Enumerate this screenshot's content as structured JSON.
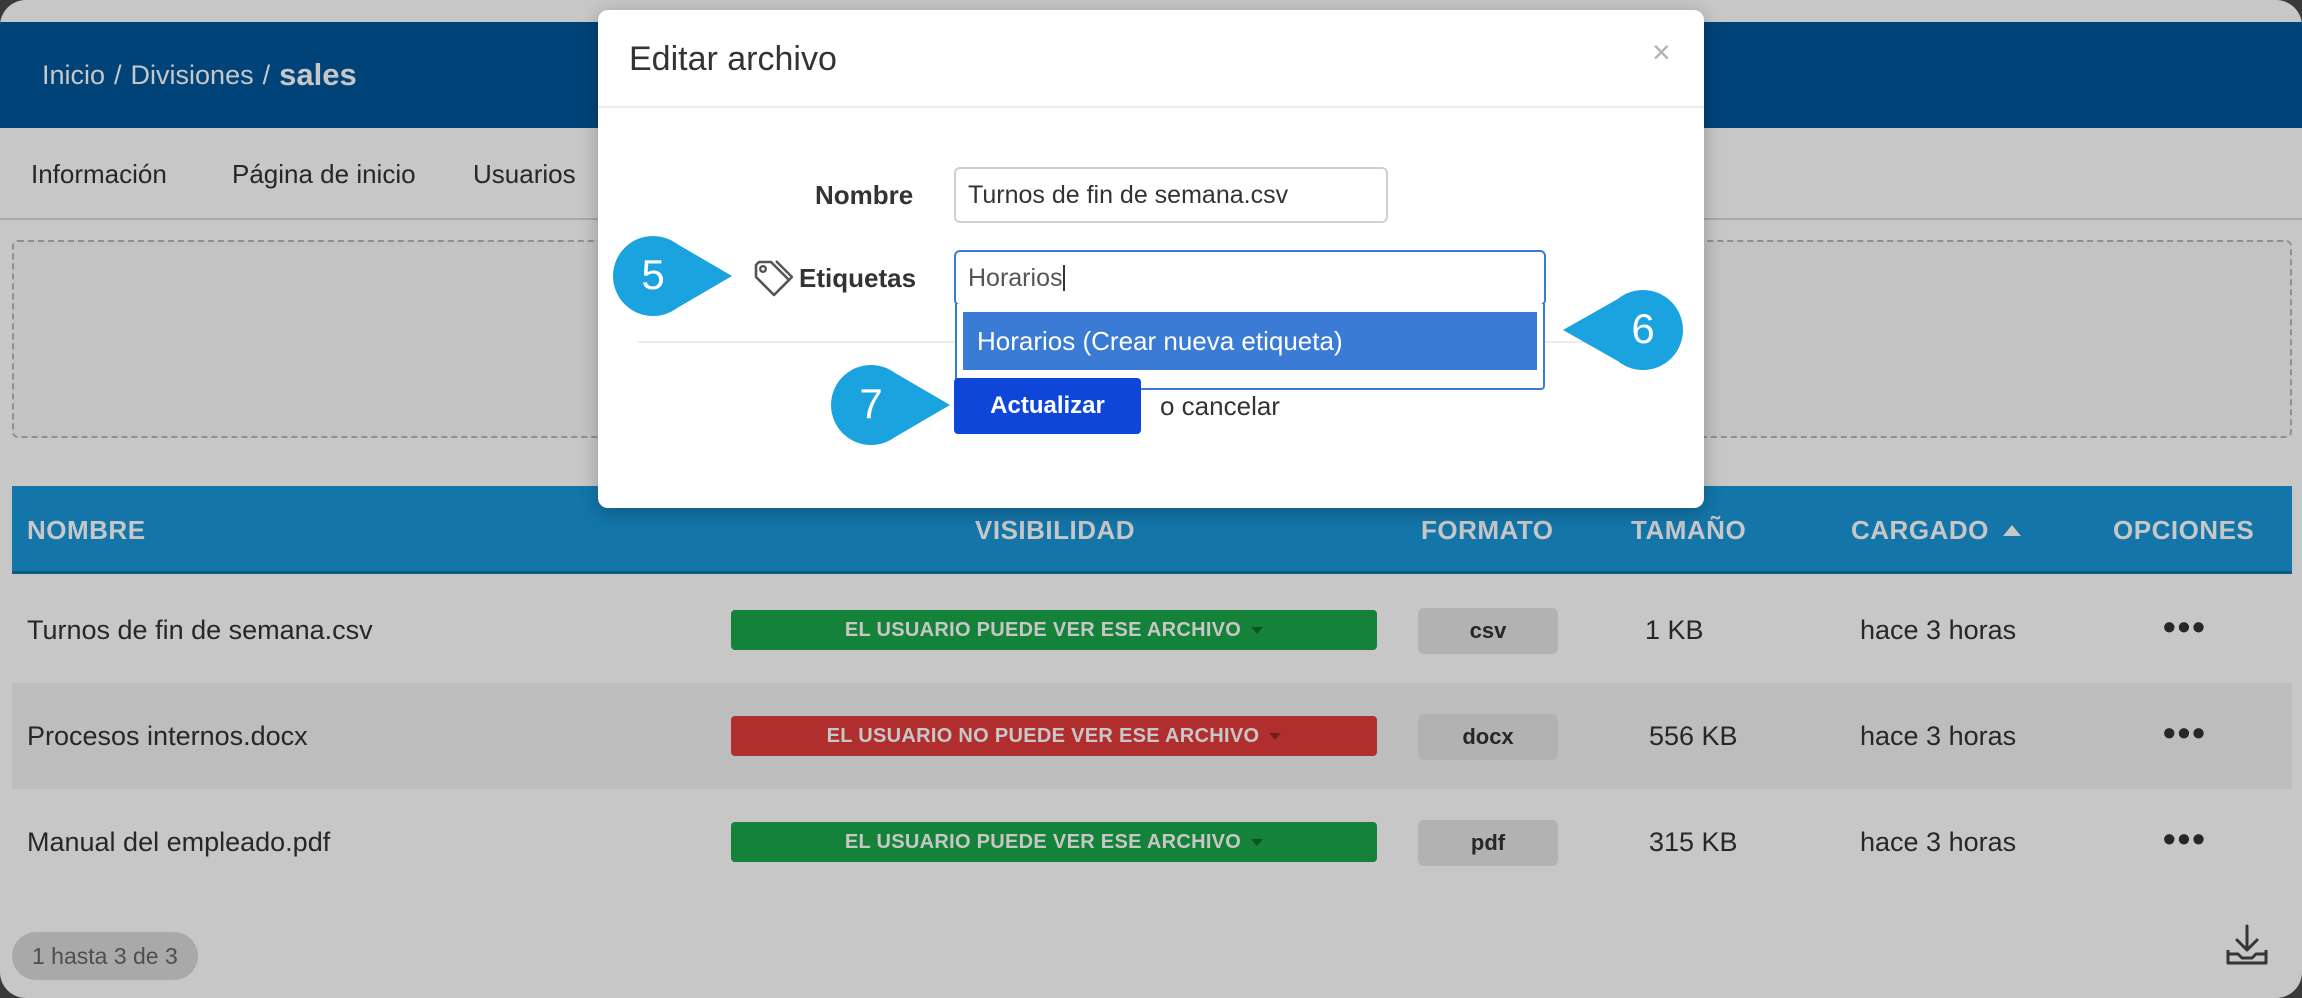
{
  "breadcrumb": {
    "home": "Inicio",
    "separator": "/",
    "divisions": "Divisiones",
    "current": "sales"
  },
  "tabs": [
    "Información",
    "Página de inicio",
    "Usuarios"
  ],
  "table": {
    "headers": {
      "name": "NOMBRE",
      "visibility": "VISIBILIDAD",
      "format": "FORMATO",
      "size": "TAMAÑO",
      "uploaded": "CARGADO",
      "options": "OPCIONES"
    },
    "rows": [
      {
        "name": "Turnos de fin de semana.csv",
        "visibility": "EL USUARIO PUEDE VER ESE ARCHIVO",
        "visibility_status": "visible",
        "format": "csv",
        "size": "1 KB",
        "uploaded": "hace 3 horas",
        "options": "•••"
      },
      {
        "name": "Procesos internos.docx",
        "visibility": "EL USUARIO NO PUEDE VER ESE ARCHIVO",
        "visibility_status": "hidden",
        "format": "docx",
        "size": "556 KB",
        "uploaded": "hace 3 horas",
        "options": "•••"
      },
      {
        "name": "Manual del empleado.pdf",
        "visibility": "EL USUARIO PUEDE VER ESE ARCHIVO",
        "visibility_status": "visible",
        "format": "pdf",
        "size": "315 KB",
        "uploaded": "hace 3 horas",
        "options": "•••"
      }
    ]
  },
  "pager": "1 hasta 3 de 3",
  "modal": {
    "title": "Editar archivo",
    "close": "×",
    "name_label": "Nombre",
    "name_value": "Turnos de fin de semana.csv",
    "tags_label": "Etiquetas",
    "tags_value": "Horarios",
    "tag_option": "Horarios (Crear nueva etiqueta)",
    "update_button": "Actualizar",
    "cancel_text": "o cancelar"
  },
  "callouts": [
    "5",
    "6",
    "7"
  ],
  "colors": {
    "header_blue": "#00569b",
    "table_header": "#1996d8",
    "visible_green": "#1ba74a",
    "hidden_red": "#e23c3c",
    "primary_button": "#0d46d9",
    "callout": "#1aa3df"
  }
}
